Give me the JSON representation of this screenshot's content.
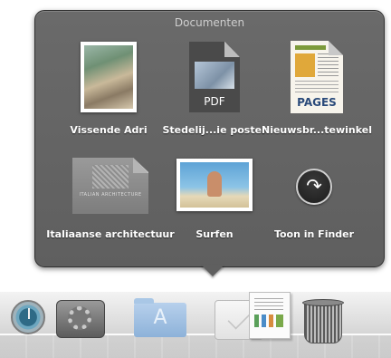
{
  "stack": {
    "title": "Documenten",
    "items": [
      {
        "label": "Vissende Adri"
      },
      {
        "label": "Stedelij...ie poster",
        "badge": "PDF"
      },
      {
        "label": "Nieuwsbr...tewinkel",
        "badge": "PAGES"
      },
      {
        "label": "Italiaanse architectuur",
        "thumb_text": "ITALIAN ARCHITECTURE"
      },
      {
        "label": "Surfen"
      },
      {
        "label": "Toon in Finder",
        "icon": "arrow-curved-right-icon"
      }
    ]
  },
  "dock": {
    "items": [
      {
        "name": "time-machine-icon"
      },
      {
        "name": "system-preferences-icon"
      },
      {
        "name": "applications-folder-icon"
      },
      {
        "name": "documents-stack-icon"
      },
      {
        "name": "numbers-document-icon"
      },
      {
        "name": "trash-icon"
      }
    ]
  }
}
